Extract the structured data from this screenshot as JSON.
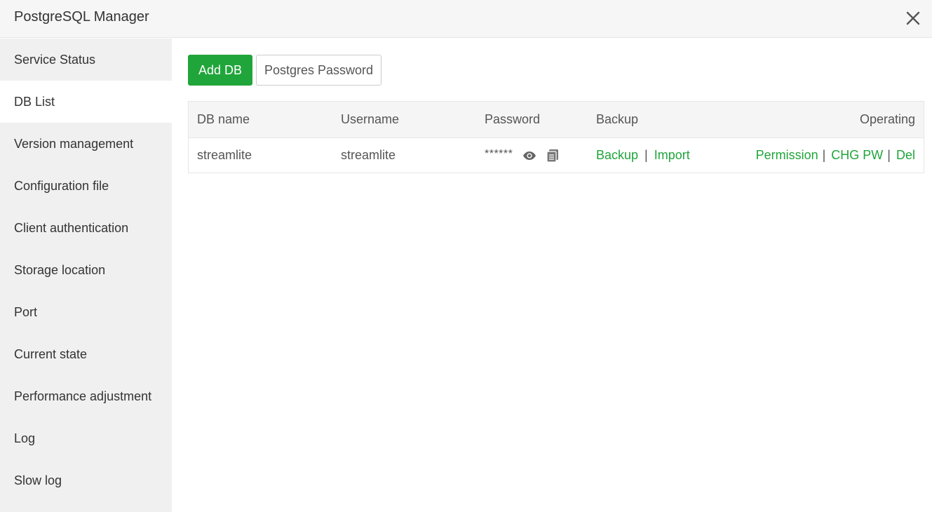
{
  "window": {
    "title": "PostgreSQL Manager"
  },
  "sidebar": {
    "items": [
      {
        "label": "Service Status"
      },
      {
        "label": "DB List"
      },
      {
        "label": "Version management"
      },
      {
        "label": "Configuration file"
      },
      {
        "label": "Client authentication"
      },
      {
        "label": "Storage location"
      },
      {
        "label": "Port"
      },
      {
        "label": "Current state"
      },
      {
        "label": "Performance adjustment"
      },
      {
        "label": "Log"
      },
      {
        "label": "Slow log"
      }
    ],
    "active": "DB List"
  },
  "toolbar": {
    "add_db_label": "Add DB",
    "postgres_password_label": "Postgres Password"
  },
  "table": {
    "headers": {
      "db_name": "DB name",
      "username": "Username",
      "password": "Password",
      "backup": "Backup",
      "operating": "Operating"
    },
    "rows": [
      {
        "db_name": "streamlite",
        "username": "streamlite",
        "password_masked": "******",
        "backup_link": "Backup",
        "import_link": "Import",
        "permission_link": "Permission",
        "chg_pw_link": "CHG PW",
        "del_link": "Del"
      }
    ],
    "separator": "|"
  },
  "icons": {
    "close": "close-icon",
    "show_password": "eye-icon",
    "copy_password": "copy-icon"
  },
  "colors": {
    "accent": "#20a53a",
    "sidebar_bg": "#f0f0f0",
    "header_bg": "#f6f6f6"
  }
}
